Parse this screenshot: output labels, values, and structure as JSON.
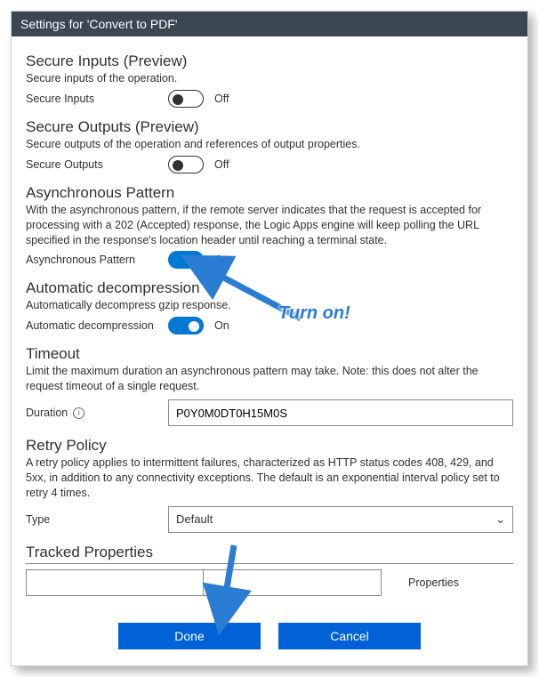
{
  "titlebar": "Settings for 'Convert to PDF'",
  "secureInputs": {
    "title": "Secure Inputs (Preview)",
    "desc": "Secure inputs of the operation.",
    "label": "Secure Inputs",
    "state": "Off"
  },
  "secureOutputs": {
    "title": "Secure Outputs (Preview)",
    "desc": "Secure outputs of the operation and references of output properties.",
    "label": "Secure Outputs",
    "state": "Off"
  },
  "asyncPattern": {
    "title": "Asynchronous Pattern",
    "desc": "With the asynchronous pattern, if the remote server indicates that the request is accepted for processing with a 202 (Accepted) response, the Logic Apps engine will keep polling the URL specified in the response's location header until reaching a terminal state.",
    "label": "Asynchronous Pattern",
    "state": "On"
  },
  "autoDecomp": {
    "title": "Automatic decompression",
    "desc": "Automatically decompress gzip response.",
    "label": "Automatic decompression",
    "state": "On"
  },
  "timeout": {
    "title": "Timeout",
    "desc": "Limit the maximum duration an asynchronous pattern may take. Note: this does not alter the request timeout of a single request.",
    "label": "Duration",
    "value": "P0Y0M0DT0H15M0S"
  },
  "retry": {
    "title": "Retry Policy",
    "desc": "A retry policy applies to intermittent failures, characterized as HTTP status codes 408, 429, and 5xx, in addition to any connectivity exceptions. The default is an exponential interval policy set to retry 4 times.",
    "label": "Type",
    "value": "Default"
  },
  "tracked": {
    "title": "Tracked Properties",
    "propLabel": "Properties"
  },
  "buttons": {
    "done": "Done",
    "cancel": "Cancel"
  },
  "annotation": {
    "turnOn": "Turn on!"
  },
  "colors": {
    "accent": "#0078d4",
    "button": "#0062d6",
    "annot": "#2b7cd3"
  }
}
